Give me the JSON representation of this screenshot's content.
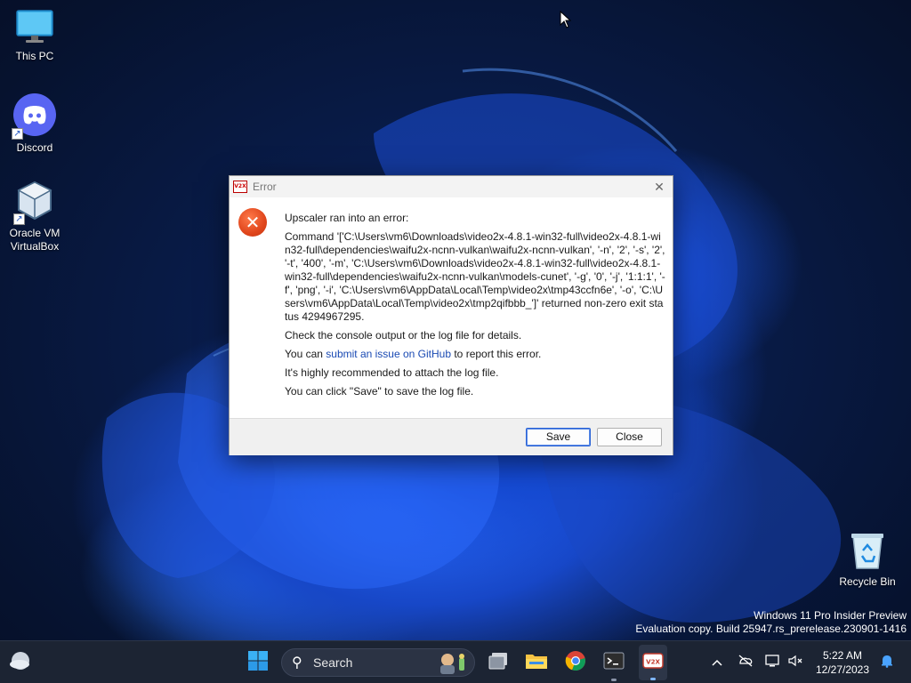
{
  "desktop": {
    "icons": [
      {
        "label": "This PC",
        "icon": "monitor-icon"
      },
      {
        "label": "Discord",
        "icon": "discord-icon"
      },
      {
        "label": "Oracle VM\nVirtualBox",
        "icon": "virtualbox-icon"
      },
      {
        "label": "Recycle Bin",
        "icon": "recycle-bin-icon"
      }
    ],
    "watermark": {
      "line1": "Windows 11 Pro Insider Preview",
      "line2": "Evaluation copy. Build 25947.rs_prerelease.230901-1416"
    }
  },
  "dialog": {
    "title": "Error",
    "app_icon_text": "V2X",
    "heading": "Upscaler ran into an error:",
    "command": "Command '['C:\\Users\\vm6\\Downloads\\video2x-4.8.1-win32-full\\video2x-4.8.1-win32-full\\dependencies\\waifu2x-ncnn-vulkan\\waifu2x-ncnn-vulkan', '-n', '2', '-s', '2', '-t', '400', '-m', 'C:\\Users\\vm6\\Downloads\\video2x-4.8.1-win32-full\\video2x-4.8.1-win32-full\\dependencies\\waifu2x-ncnn-vulkan\\models-cunet', '-g', '0', '-j', '1:1:1', '-f', 'png', '-i', 'C:\\Users\\vm6\\AppData\\Local\\Temp\\video2x\\tmp43ccfn6e', '-o', 'C:\\Users\\vm6\\AppData\\Local\\Temp\\video2x\\tmp2qifbbb_']' returned non-zero exit status 4294967295.",
    "check_line": "Check the console output or the log file for details.",
    "issue_prefix": "You can ",
    "issue_link": "submit an issue on GitHub",
    "issue_suffix": " to report this error.",
    "recommend_line": "It's highly recommended to attach the log file.",
    "save_hint": "You can click \"Save\" to save the log file.",
    "buttons": {
      "save": "Save",
      "close": "Close"
    }
  },
  "taskbar": {
    "search_label": "Search",
    "time": "5:22 AM",
    "date": "12/27/2023",
    "pinned": [
      "start-icon",
      "search",
      "task-view-icon",
      "file-explorer-icon",
      "chrome-icon",
      "terminal-icon",
      "video2x-icon"
    ],
    "tray": [
      "chevron-up-icon",
      "network-off-icon",
      "display-icon",
      "volume-mute-icon",
      "notification-bell-icon"
    ]
  }
}
